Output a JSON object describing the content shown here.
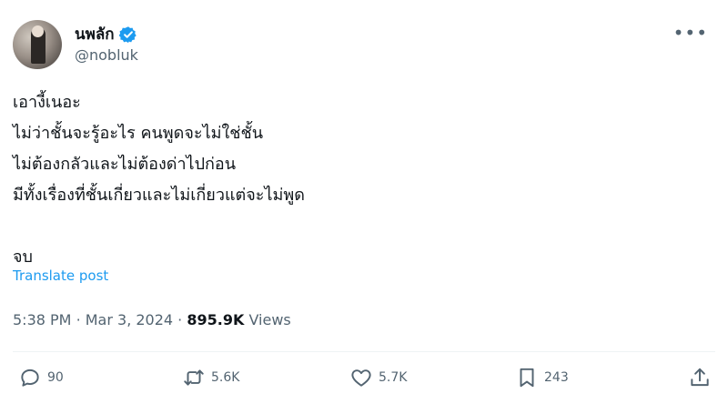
{
  "author": {
    "display_name": "นพลัก",
    "handle": "@nobluk",
    "verified": true
  },
  "post": {
    "text": "เอางี้เนอะ\nไม่ว่าชั้นจะรู้อะไร คนพูดจะไม่ใช่ชั้น\nไม่ต้องกลัวและไม่ต้องด่าไปก่อน\nมีทั้งเรื่องที่ชั้นเกี่ยวและไม่เกี่ยวแต่จะไม่พูด\n\nจบ",
    "translate_label": "Translate post",
    "time": "5:38 PM",
    "date": "Mar 3, 2024",
    "views_count": "895.9K",
    "views_label": "Views"
  },
  "actions": {
    "replies": "90",
    "reposts": "5.6K",
    "likes": "5.7K",
    "bookmarks": "243"
  },
  "colors": {
    "accent": "#1d9bf0",
    "secondary_text": "#536471",
    "divider": "#eff3f4"
  },
  "icons": [
    "more-icon",
    "verified-badge-icon",
    "reply-icon",
    "repost-icon",
    "like-icon",
    "bookmark-icon",
    "share-icon"
  ]
}
